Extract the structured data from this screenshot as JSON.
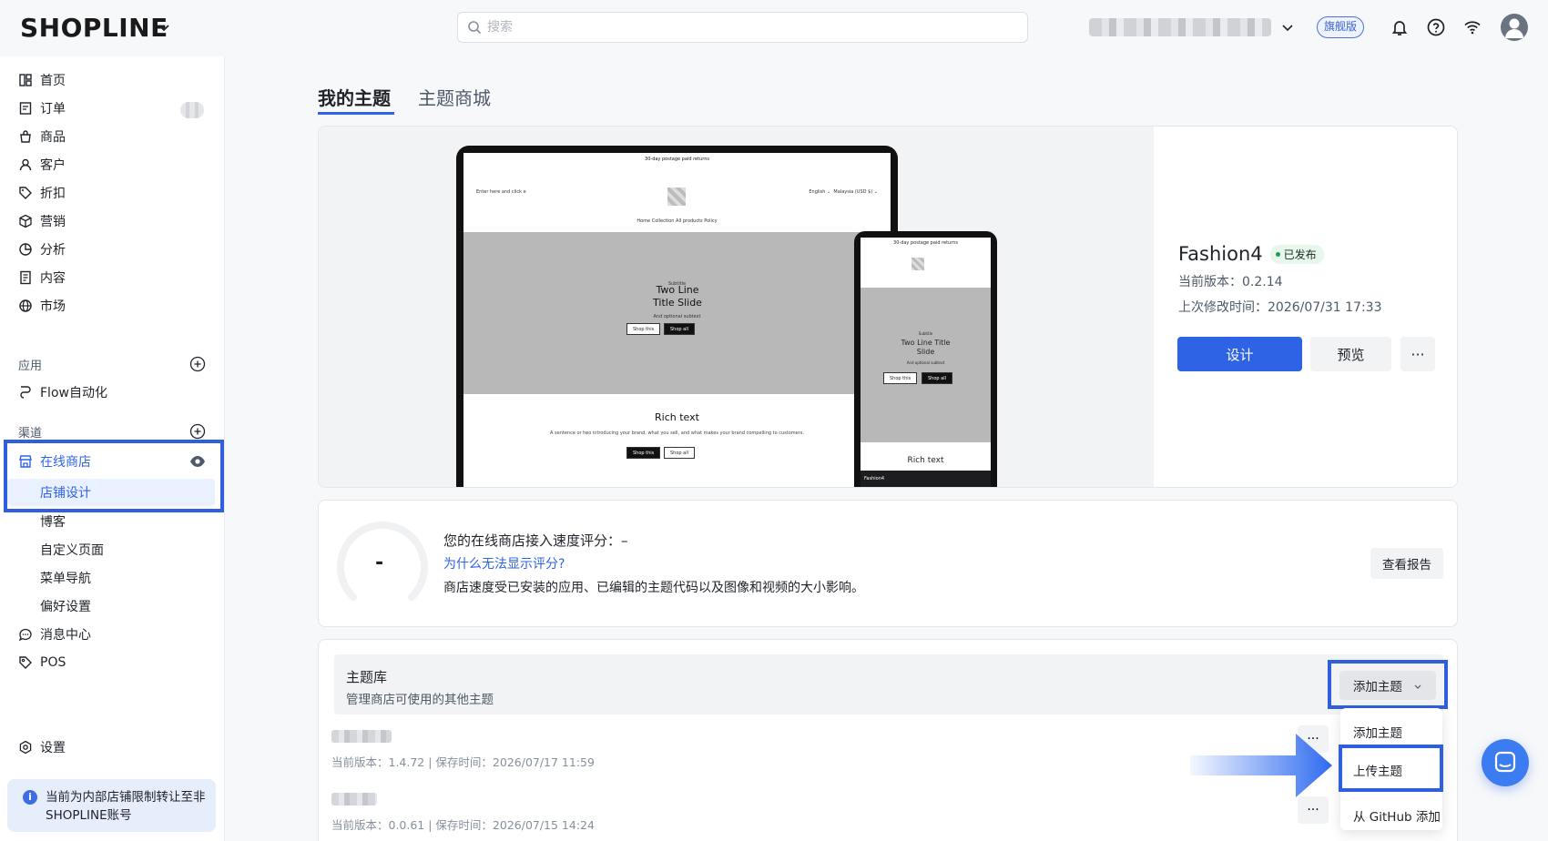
{
  "header": {
    "logo": "SHOPLINE",
    "search_placeholder": "搜索",
    "plan_badge": "旗舰版"
  },
  "sidebar": {
    "items": [
      {
        "label": "首页"
      },
      {
        "label": "订单"
      },
      {
        "label": "商品"
      },
      {
        "label": "客户"
      },
      {
        "label": "折扣"
      },
      {
        "label": "营销"
      },
      {
        "label": "分析"
      },
      {
        "label": "内容"
      },
      {
        "label": "市场"
      }
    ],
    "apps_section": "应用",
    "flow_item": "Flow自动化",
    "channels_section": "渠道",
    "online_store": "在线商店",
    "store_design": "店铺设计",
    "sub_items": [
      "博客",
      "自定义页面",
      "菜单导航",
      "偏好设置"
    ],
    "message_center": "消息中心",
    "pos": "POS",
    "settings": "设置",
    "notice": "当前为内部店铺限制转让至非SHOPLINE账号"
  },
  "tabs": {
    "my_themes": "我的主题",
    "theme_store": "主题商城"
  },
  "preview": {
    "announcement": "30-day postage paid returns",
    "search_text": "Enter here and click e",
    "lang": "English ⌄",
    "currency": "Malaysia (USD $) ⌄",
    "menu": "Home    Collection    All products    Policy",
    "subtitle": "Subtitle",
    "hero_title": "Two Line Title Slide",
    "hero_small": "And optional subtext",
    "shop_this": "Shop this",
    "shop_all": "Shop all",
    "rich_title": "Rich text",
    "rich_desc": "A sentence or two introducing your brand, what you sell, and what makes your brand compelling to customers.",
    "phone_bar": "Fashion4"
  },
  "theme": {
    "name": "Fashion4",
    "status": "已发布",
    "version": "当前版本：0.2.14",
    "modified": "上次修改时间：2026/07/31 17:33",
    "design_btn": "设计",
    "preview_btn": "预览",
    "more_btn": "···"
  },
  "speed": {
    "value": "-",
    "title": "您的在线商店接入速度评分：–",
    "link": "为什么无法显示评分?",
    "desc": "商店速度受已安装的应用、已编辑的主题代码以及图像和视频的大小影响。",
    "report_btn": "查看报告"
  },
  "library": {
    "title": "主题库",
    "subtitle": "管理商店可使用的其他主题",
    "add_btn": "添加主题",
    "rows": [
      {
        "meta": "当前版本：1.4.72  |  保存时间：2026/07/17 11:59"
      },
      {
        "meta": "当前版本：0.0.61  |  保存时间：2026/07/15 14:24"
      }
    ],
    "row_more": "···"
  },
  "dropdown": {
    "items": [
      "添加主题",
      "上传主题",
      "从 GitHub 添加"
    ]
  },
  "colors": {
    "accent": "#2e63e6",
    "highlight": "#2f5fdd",
    "published": "#1f9d55"
  }
}
